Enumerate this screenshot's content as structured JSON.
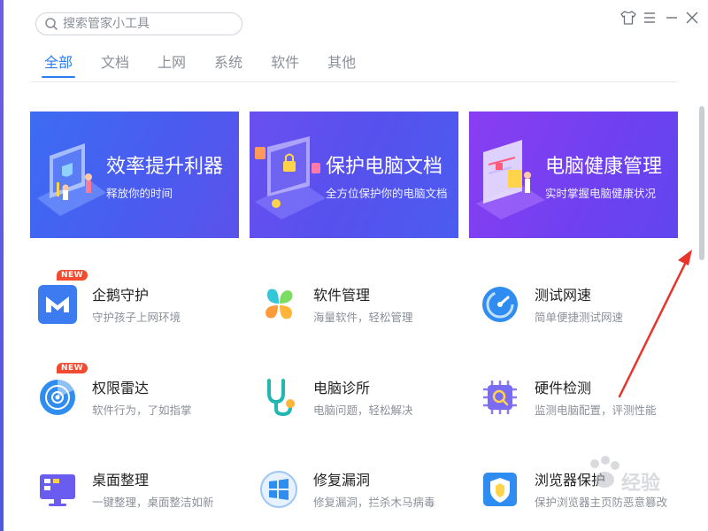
{
  "search": {
    "placeholder": "搜索管家小工具",
    "value": ""
  },
  "tabs": [
    {
      "label": "全部",
      "active": true
    },
    {
      "label": "文档",
      "active": false
    },
    {
      "label": "上网",
      "active": false
    },
    {
      "label": "系统",
      "active": false
    },
    {
      "label": "软件",
      "active": false
    },
    {
      "label": "其他",
      "active": false
    }
  ],
  "window_controls": [
    "skin-icon",
    "menu-icon",
    "minimize-icon",
    "close-icon"
  ],
  "banners": [
    {
      "title": "效率提升利器",
      "subtitle": "释放你的时间",
      "icon": "efficiency-illustration"
    },
    {
      "title": "保护电脑文档",
      "subtitle": "全方位保护你的电脑文档",
      "icon": "document-lock-illustration"
    },
    {
      "title": "电脑健康管理",
      "subtitle": "实时掌握电脑健康状况",
      "icon": "health-chart-illustration"
    }
  ],
  "tools": [
    {
      "name": "企鹅守护",
      "desc": "守护孩子上网环境",
      "icon": "penguin-guard-icon",
      "badge": "NEW"
    },
    {
      "name": "软件管理",
      "desc": "海量软件，轻松管理",
      "icon": "software-manager-icon",
      "badge": ""
    },
    {
      "name": "测试网速",
      "desc": "简单便捷测试网速",
      "icon": "speedometer-icon",
      "badge": ""
    },
    {
      "name": "权限雷达",
      "desc": "软件行为，了如指掌",
      "icon": "radar-icon",
      "badge": "NEW"
    },
    {
      "name": "电脑诊所",
      "desc": "电脑问题，轻松解决",
      "icon": "stethoscope-icon",
      "badge": ""
    },
    {
      "name": "硬件检测",
      "desc": "监测电脑配置，评测性能",
      "icon": "chip-icon",
      "badge": ""
    },
    {
      "name": "桌面整理",
      "desc": "一键整理，桌面整洁如新",
      "icon": "desktop-icon",
      "badge": ""
    },
    {
      "name": "修复漏洞",
      "desc": "修复漏洞，拦杀木马病毒",
      "icon": "windows-icon",
      "badge": ""
    },
    {
      "name": "浏览器保护",
      "desc": "保护浏览器主页防恶意篡改",
      "icon": "browser-shield-icon",
      "badge": ""
    }
  ],
  "watermark": {
    "text": "经验"
  },
  "colors": {
    "accent": "#2b7cf0",
    "annotation": "#e8342a",
    "badge": "#f24b32"
  }
}
